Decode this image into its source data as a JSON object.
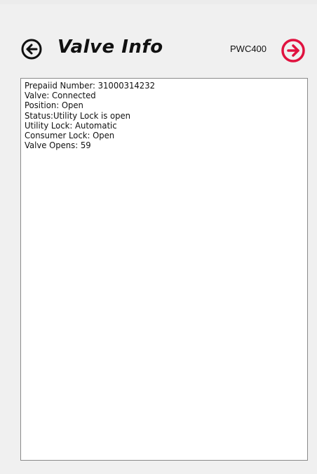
{
  "header": {
    "title": "Valve Info",
    "device_model": "PWC400",
    "back_icon": "arrow-left-circle-icon",
    "forward_icon": "arrow-right-circle-icon",
    "accent_color": "#e0123f"
  },
  "info": {
    "lines": [
      "Prepaiid Number: 31000314232",
      "Valve: Connected",
      "Position: Open",
      "Status:Utility Lock is open",
      "Utility Lock: Automatic",
      "Consumer Lock: Open",
      "Valve Opens: 59"
    ]
  }
}
